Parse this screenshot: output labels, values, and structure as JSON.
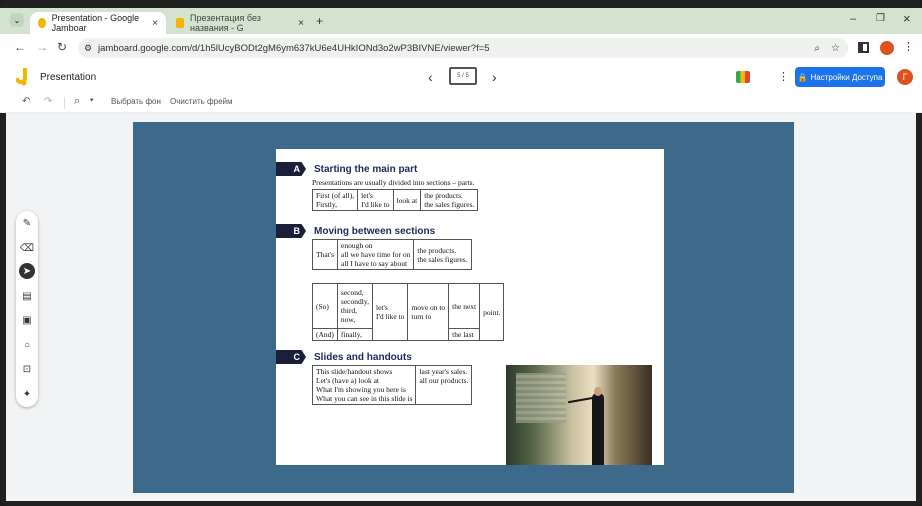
{
  "tabs": [
    {
      "title": "Presentation - Google Jamboar",
      "close": "×",
      "favicon_color": "#f5b400"
    },
    {
      "title": "Презентация без названия - G",
      "close": "×",
      "favicon_color": "#f5b400"
    }
  ],
  "new_tab": "+",
  "window_controls": {
    "minimize": "–",
    "maximize": "❐",
    "close": "×"
  },
  "address": {
    "url": "jamboard.google.com/d/1h5lUcyBODt2gM6ym637kU6e4UHkIONd3o2wP3BIVNE/viewer?f=5"
  },
  "app": {
    "title": "Presentation",
    "frame_indicator": "5 / 5",
    "share_label": "Настройки Доступа",
    "avatar": "Г",
    "prev": "‹",
    "next": "›"
  },
  "toolbar": {
    "bg_label": "Выбрать фон",
    "clear_label": "Очистить фрейм"
  },
  "slide": {
    "sectionA": {
      "badge": "A",
      "title": "Starting the main part",
      "intro": "Presentations are usually divided into sections – parts.",
      "table": [
        [
          "First (of all),\nFirstly,",
          "let's\nI'd like to",
          "look at",
          "the products.\nthe sales figures."
        ]
      ]
    },
    "sectionB": {
      "badge": "B",
      "title": "Moving between sections",
      "t1": [
        "That's",
        "enough on\nall we have time for on\nall I have to say about",
        "the products.\nthe sales figures."
      ],
      "t2": {
        "so": "(So)",
        "and": "(And)",
        "ordinals": "second,\nsecondly,\nthird,\nnow,",
        "finally": "finally,",
        "like": "let's\nI'd like to",
        "move": "move on to\nturn to",
        "next": "the next",
        "last": "the last",
        "point": "point."
      }
    },
    "sectionC": {
      "badge": "C",
      "title": "Slides and handouts",
      "t1": [
        "This slide/handout shows\nLet's (have a) look at\nWhat I'm showing you here is\nWhat you can see in this slide is",
        "last year's sales.\nall our products."
      ]
    }
  }
}
